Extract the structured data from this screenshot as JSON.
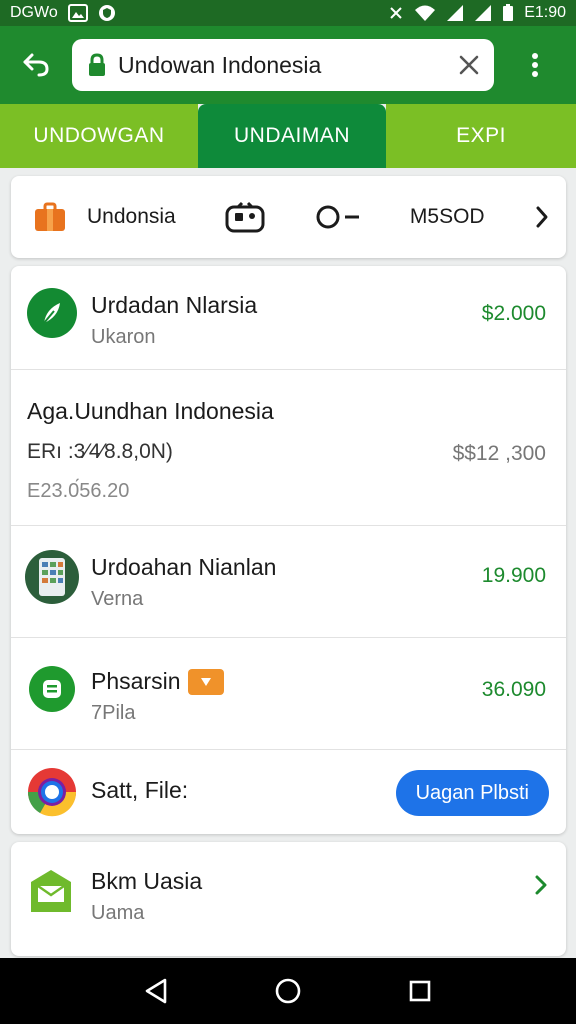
{
  "status_bar": {
    "left_text": "DGWo",
    "time": "E1:90"
  },
  "toolbar": {
    "url_text": "Undowan Indonesia"
  },
  "tabs": [
    {
      "label": "UNDOWGAN"
    },
    {
      "label": "UNDAIMAN"
    },
    {
      "label": "EXPI"
    }
  ],
  "shortcut_bar": {
    "item1_label": "Undonsia",
    "item4_label": "M5SOD",
    "item3_label": "O–"
  },
  "list": {
    "row1": {
      "title": "Urdadan Nlarsia",
      "sub": "Ukaron",
      "amount": "$2.000"
    },
    "row2": {
      "title": "Aga.Uundhan Indonesia",
      "sub1": "ERı :3⁄4⁄8.8,0N)",
      "sub2": "E23.0́56.20",
      "amount": "$$12 ,300"
    },
    "row3": {
      "title": "Urdoahan Nianlan",
      "sub": "Verna",
      "amount": "19.900"
    },
    "row4": {
      "title": "Phsarsin",
      "sub": "7Pila",
      "amount": "36.090"
    },
    "row5": {
      "title": "Satt, File:",
      "button": "Uagan Plbsti"
    }
  },
  "bottom_card": {
    "title": "Bkm Uasia",
    "sub": "Uama"
  },
  "colors": {
    "toolbar_green": "#1f8a2e",
    "tab_light": "#7bbf25",
    "tab_active": "#0e8a3a",
    "amount_green": "#1d8a2e",
    "button_blue": "#1e73e8"
  }
}
